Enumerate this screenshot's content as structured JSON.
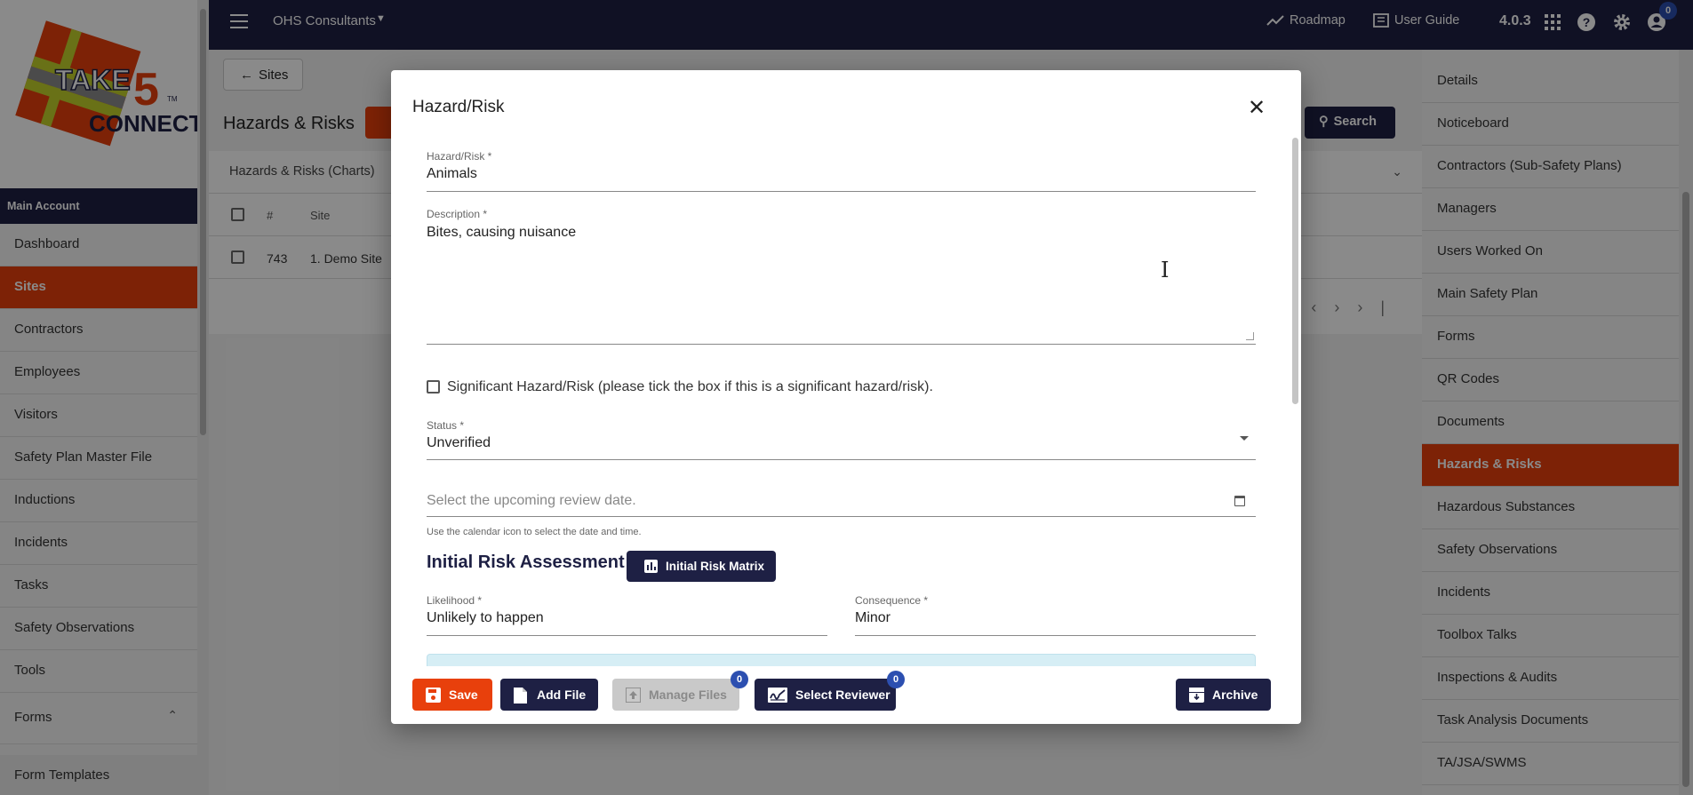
{
  "topbar": {
    "org_name": "OHS Consultants",
    "roadmap_label": "Roadmap",
    "user_guide_label": "User Guide",
    "version": "4.0.3",
    "notification_count": "0"
  },
  "sidebar": {
    "account_header": "Main Account",
    "items": [
      {
        "label": "Dashboard"
      },
      {
        "label": "Sites"
      },
      {
        "label": "Contractors"
      },
      {
        "label": "Employees"
      },
      {
        "label": "Visitors"
      },
      {
        "label": "Safety Plan Master File"
      },
      {
        "label": "Inductions"
      },
      {
        "label": "Incidents"
      },
      {
        "label": "Tasks"
      },
      {
        "label": "Safety Observations"
      },
      {
        "label": "Tools"
      },
      {
        "label": "Forms"
      }
    ],
    "sub_item": "Form Templates"
  },
  "main": {
    "back_label": "Sites",
    "page_title": "Hazards & Risks",
    "search_label": "Search",
    "charts_label": "Hazards & Risks (Charts)",
    "table": {
      "headers": [
        "#",
        "Site"
      ],
      "rows": [
        {
          "id": "743",
          "site": "1. Demo Site"
        }
      ]
    }
  },
  "right_sidebar": {
    "items": [
      {
        "label": "Details"
      },
      {
        "label": "Noticeboard"
      },
      {
        "label": "Contractors (Sub-Safety Plans)"
      },
      {
        "label": "Managers"
      },
      {
        "label": "Users Worked On"
      },
      {
        "label": "Main Safety Plan"
      },
      {
        "label": "Forms"
      },
      {
        "label": "QR Codes"
      },
      {
        "label": "Documents"
      },
      {
        "label": "Hazards & Risks"
      },
      {
        "label": "Hazardous Substances"
      },
      {
        "label": "Safety Observations"
      },
      {
        "label": "Incidents"
      },
      {
        "label": "Toolbox Talks"
      },
      {
        "label": "Inspections & Audits"
      },
      {
        "label": "Task Analysis Documents"
      },
      {
        "label": "TA/JSA/SWMS"
      }
    ]
  },
  "modal": {
    "title": "Hazard/Risk",
    "hazard_label": "Hazard/Risk *",
    "hazard_value": "Animals",
    "description_label": "Description *",
    "description_value": "Bites, causing nuisance",
    "significant_label": "Significant Hazard/Risk (please tick the box if this is a significant hazard/risk).",
    "significant_checked": false,
    "status_label": "Status *",
    "status_value": "Unverified",
    "review_date_placeholder": "Select the upcoming review date.",
    "review_date_hint": "Use the calendar icon to select the date and time.",
    "initial_assessment_title": "Initial Risk Assessment",
    "matrix_button": "Initial Risk Matrix",
    "likelihood_label": "Likelihood *",
    "likelihood_value": "Unlikely to happen",
    "consequence_label": "Consequence *",
    "consequence_value": "Minor",
    "buttons": {
      "save": "Save",
      "add_file": "Add File",
      "manage_files": "Manage Files",
      "manage_files_count": "0",
      "select_reviewer": "Select Reviewer",
      "select_reviewer_count": "0",
      "archive": "Archive"
    }
  },
  "colors": {
    "navy": "#1e2044",
    "accent_orange": "#e8400c",
    "badge_blue": "#2c4fb0"
  }
}
